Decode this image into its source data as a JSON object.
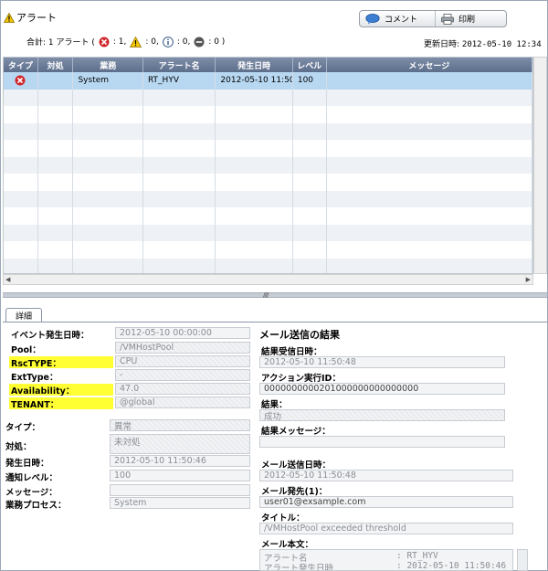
{
  "header": {
    "title": "アラート",
    "comment_label": "コメント",
    "print_label": "印刷",
    "summary_prefix": "合計: 1 アラート (",
    "error_count": ": 1,",
    "warning_count": ": 0,",
    "info_count": ": 0,",
    "unknown_count": ": 0 )",
    "updated_label": "更新日時:",
    "updated_value": "2012-05-10 12:34"
  },
  "grid": {
    "columns": [
      "タイプ",
      "対処",
      "業務",
      "アラート名",
      "発生日時",
      "レベル",
      "メッセージ"
    ],
    "rows": [
      {
        "type_icon": "error-icon",
        "action": "",
        "business": "System",
        "alert_name": "RT_HYV",
        "occurred": "2012-05-10 11:50",
        "level": "100",
        "message": ""
      }
    ],
    "empty_rows": 11
  },
  "details_tab": "詳細",
  "event": {
    "occurred_label": "イベント発生日時：",
    "occurred_value": "2012-05-10 00:00:00",
    "pool_label": "Pool：",
    "pool_value": "/VMHostPool",
    "rsctype_label": "RscTYPE：",
    "rsctype_value": "CPU",
    "exttype_label": "ExtType：",
    "exttype_value": "-",
    "availability_label": "Availability：",
    "availability_value": "47.0",
    "tenant_label": "TENANT：",
    "tenant_value": "@global"
  },
  "info": {
    "type_label": "タイプ：",
    "type_value": "異常",
    "action_label": "対処：",
    "action_value": "未対処",
    "occurred_label": "発生日時：",
    "occurred_value": "2012-05-10 11:50:46",
    "level_label": "通知レベル：",
    "level_value": "100",
    "message_label": "メッセージ：",
    "message_value": "",
    "process_label": "業務プロセス：",
    "process_value": "System"
  },
  "mail": {
    "section_title": "メール送信の結果",
    "received_label": "結果受信日時：",
    "received_value": "2012-05-10 11:50:48",
    "action_id_label": "アクション実行ID：",
    "action_id_value": "0000000000201000000000000000",
    "result_label": "結果：",
    "result_value": "成功",
    "result_msg_label": "結果メッセージ：",
    "result_msg_value": "",
    "sent_label": "メール送信日時：",
    "sent_value": "2012-05-10 11:50:48",
    "to_label": "メール発先(1)：",
    "to_value": "user01@exsample.com",
    "title_label": "タイトル：",
    "title_value": "/VMHostPool exceeded threshold",
    "body_label": "メール本文：",
    "body_lines": [
      {
        "key": "アラート名",
        "value": ": RT_HYV"
      },
      {
        "key": "アラート発生日時",
        "value": ": 2012-05-10 11:50:46"
      }
    ]
  },
  "colors": {
    "highlight": "#ffff33",
    "grid_header": "#6b7b98",
    "selected_row": "#b8d8f2",
    "error": "#d0262c",
    "warning": "#f3c600"
  }
}
